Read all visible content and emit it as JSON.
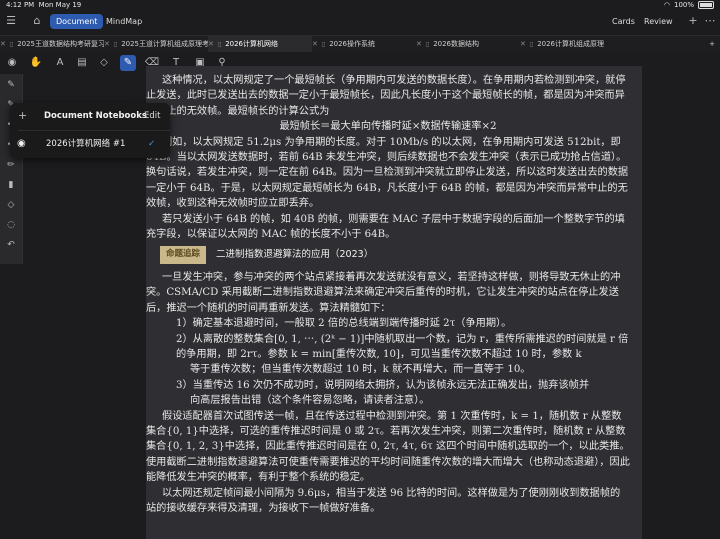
{
  "status": {
    "time": "4:12 PM",
    "date": "Mon May 19",
    "battery": "100%",
    "battery_level": 1.0
  },
  "topbar": {
    "document_label": "Document",
    "mindmap_label": "MindMap",
    "cards_label": "Cards",
    "review_label": "Review",
    "icons": [
      "sidebar-icon",
      "library-icon",
      "plus-icon",
      "more-icon"
    ]
  },
  "tabs": [
    {
      "label": "2025王道数据结构考研复习..."
    },
    {
      "label": "2025王道计算机组成原理考..."
    },
    {
      "label": "2026计算机网络"
    },
    {
      "label": "2026操作系统"
    },
    {
      "label": "2026数据结构"
    },
    {
      "label": "2026计算机组成原理"
    }
  ],
  "popover": {
    "title": "Document Notebooks",
    "edit_label": "Edit",
    "item_label": "2026计算机网络 #1",
    "add_symbol": "+",
    "check_symbol": "✓"
  },
  "doc": {
    "lines_top": "这种情况，以太网规定了一个最短帧长（争用期内可发送的数据长度）。在争用期内若检测到冲突，就停止发送，此时已发送出去的数据一定小于最短帧长，因此凡长度小于这个最短帧长的帧，都是因为冲突而异常中止的无效帧。最短帧长的计算公式为",
    "formula": "最短帧长＝最大单向传播时延×数据传输速率×2",
    "p1": "例如，以太网规定 51.2μs 为争用期的长度。对于 10Mb/s 的以太网，在争用期内可发送 512bit，即 64B。当以太网发送数据时，若前 64B 未发生冲突，则后续数据也不会发生冲突（表示已成功抢占信道）。换句话说，若发生冲突，则一定在前 64B。因为一旦检测到冲突就立即停止发送，所以这时发送出去的数据一定小于 64B。于是，以太网规定最短帧长为 64B，凡长度小于 64B 的帧，都是因为冲突而异常中止的无效帧，收到这种无效帧时应立即丢弃。",
    "p2": "若只发送小于 64B 的帧，如 40B 的帧，则需要在 MAC 子层中于数据字段的后面加一个整数字节的填充字段，以保证以太网的 MAC 帧的长度不小于 64B。",
    "badge": "命题追踪",
    "section_title": "二进制指数退避算法的应用（2023）",
    "p3": "一旦发生冲突，参与冲突的两个站点紧接着再次发送就没有意义，若坚持这样做，则将导致无休止的冲突。CSMA/CD 采用截断二进制指数退避算法来确定冲突后重传的时机，它让发生冲突的站点在停止发送后，推迟一个随机的时间再重新发送。算法精髓如下：",
    "list1": "1）确定基本退避时间，一般取 2 倍的总线端到端传播时延 2τ（争用期）。",
    "list2a": "2）从离散的整数集合[0, 1, ⋯, (2ᵏ − 1)]中随机取出一个数，记为 r，重传所需推迟的时间就是 r 倍的争用期，即 2rτ。参数 k = min[重传次数, 10]，可见当重传次数不超过 10 时，参数 k",
    "list2b": "等于重传次数；但当重传次数超过 10 时，k 就不再增大，而一直等于 10。",
    "list3a": "3）当重传达 16 次仍不成功时，说明网络太拥挤，认为该帧永远无法正确发出，抛弃该帧并",
    "list3b": "向高层报告出错（这个条件容易忽略，请读者注意）。",
    "p4": "假设适配器首次试图传送一帧，且在传送过程中检测到冲突。第 1 次重传时，k = 1，随机数 r 从整数集合{0, 1}中选择，可选的重传推迟时间是 0 或 2τ。若再次发生冲突，则第二次重传时，随机数 r 从整数集合{0, 1, 2, 3}中选择，因此重传推迟时间是在 0, 2τ, 4τ, 6τ 这四个时间中随机选取的一个，以此类推。使用截断二进制指数退避算法可使重传需要推迟的平均时间随重传次数的增大而增大（也称动态退避），因此能降低发生冲突的概率，有利于整个系统的稳定。",
    "p5": "以太网还规定帧间最小间隔为 9.6μs，相当于发送 96 比特的时间。这样做是为了使刚刚收到数据帧的站的接收缓存来得及清理，为接收下一帧做好准备。"
  },
  "tools": [
    "lasso-icon",
    "hand-icon",
    "text-tool-icon",
    "highlighter-icon",
    "shape-icon",
    "pen-icon",
    "eraser-icon",
    "textbox-icon",
    "image-icon",
    "link-icon"
  ],
  "rail": [
    "pen-icon",
    "pen-icon",
    "pen-icon",
    "pen-icon",
    "pencil-icon",
    "highlighter-icon",
    "eraser-icon",
    "lasso-icon",
    "shape-icon",
    "undo-icon"
  ]
}
